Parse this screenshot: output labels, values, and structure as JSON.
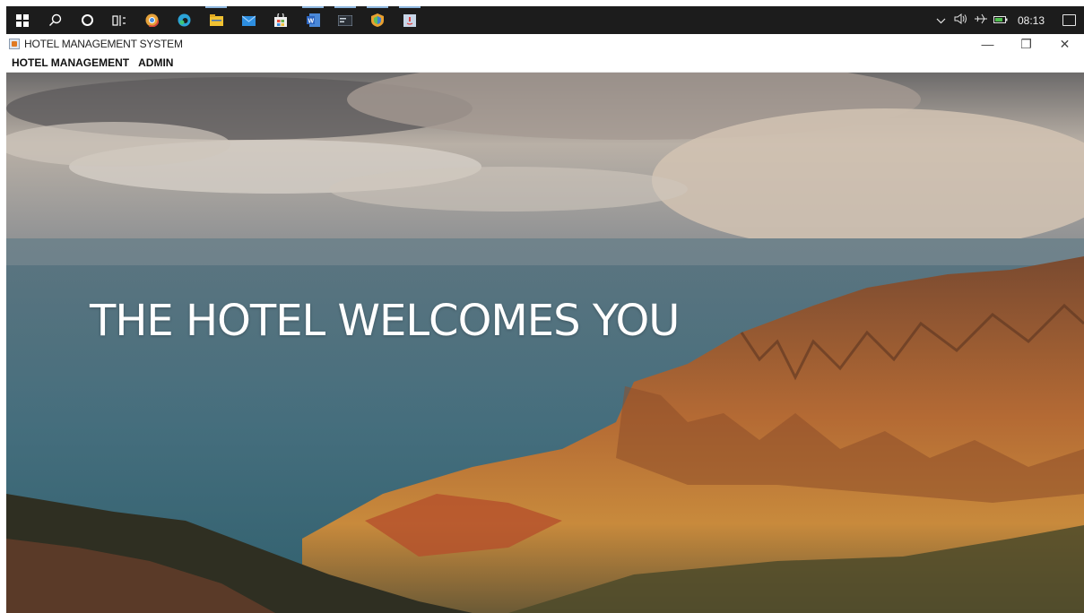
{
  "taskbar": {
    "apps": [
      {
        "name": "windows-start-icon",
        "color": "#ffffff"
      },
      {
        "name": "search-icon",
        "color": "#ffffff"
      },
      {
        "name": "cortana-icon",
        "color": "#ffffff"
      },
      {
        "name": "task-view-icon",
        "color": "#ffffff"
      },
      {
        "name": "chrome-icon",
        "color": "#e6a23a"
      },
      {
        "name": "edge-icon",
        "color": "#2ba3d8"
      },
      {
        "name": "file-explorer-icon",
        "color": "#f1c232"
      },
      {
        "name": "mail-icon",
        "color": "#2d8ee0"
      },
      {
        "name": "store-icon",
        "color": "#f0c040"
      },
      {
        "name": "word-icon",
        "color": "#2b64c0"
      },
      {
        "name": "terminal-icon",
        "color": "#5a6b7a"
      },
      {
        "name": "app-shield-icon",
        "color": "#e8a030"
      },
      {
        "name": "java-app-icon",
        "color": "#c8d6e8"
      }
    ],
    "clock": "08:13"
  },
  "window": {
    "title": "HOTEL MANAGEMENT SYSTEM",
    "minimize": "—",
    "restore": "❐",
    "close": "✕"
  },
  "menu": {
    "items": [
      "HOTEL MANAGEMENT",
      "ADMIN"
    ]
  },
  "main": {
    "welcome_text": "THE HOTEL WELCOMES YOU"
  }
}
